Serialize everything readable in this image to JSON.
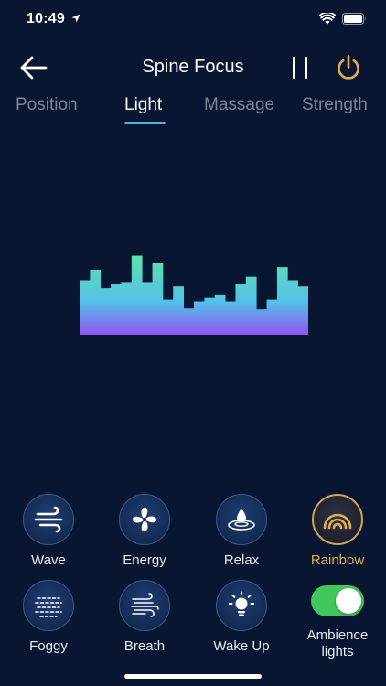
{
  "status_bar": {
    "time": "10:49"
  },
  "header": {
    "title": "Spine Focus"
  },
  "tabs": [
    {
      "label": "Position",
      "active": false
    },
    {
      "label": "Light",
      "active": true
    },
    {
      "label": "Massage",
      "active": false
    },
    {
      "label": "Strength",
      "active": false
    }
  ],
  "visualizer": {
    "levels": [
      0.62,
      0.74,
      0.53,
      0.58,
      0.6,
      0.9,
      0.6,
      0.82,
      0.4,
      0.55,
      0.3,
      0.38,
      0.42,
      0.46,
      0.38,
      0.58,
      0.66,
      0.29,
      0.4,
      0.77,
      0.62,
      0.55
    ],
    "colors": {
      "top": "#5fe8a0",
      "mid": "#53c0e8",
      "bottom": "#9b46f2"
    }
  },
  "modes": [
    {
      "label": "Wave",
      "icon": "wave-icon",
      "selected": false
    },
    {
      "label": "Energy",
      "icon": "fan-icon",
      "selected": false
    },
    {
      "label": "Relax",
      "icon": "water-drop-icon",
      "selected": false
    },
    {
      "label": "Rainbow",
      "icon": "rainbow-icon",
      "selected": true
    },
    {
      "label": "Foggy",
      "icon": "foggy-icon",
      "selected": false
    },
    {
      "label": "Breath",
      "icon": "wind-icon",
      "selected": false
    },
    {
      "label": "Wake Up",
      "icon": "sunrise-icon",
      "selected": false
    }
  ],
  "ambience": {
    "label": "Ambience lights",
    "enabled": true
  },
  "colors": {
    "background": "#081631",
    "accent": "#e2ab56",
    "tab_underline": "#4fb2e8",
    "toggle_on": "#43c65c"
  }
}
